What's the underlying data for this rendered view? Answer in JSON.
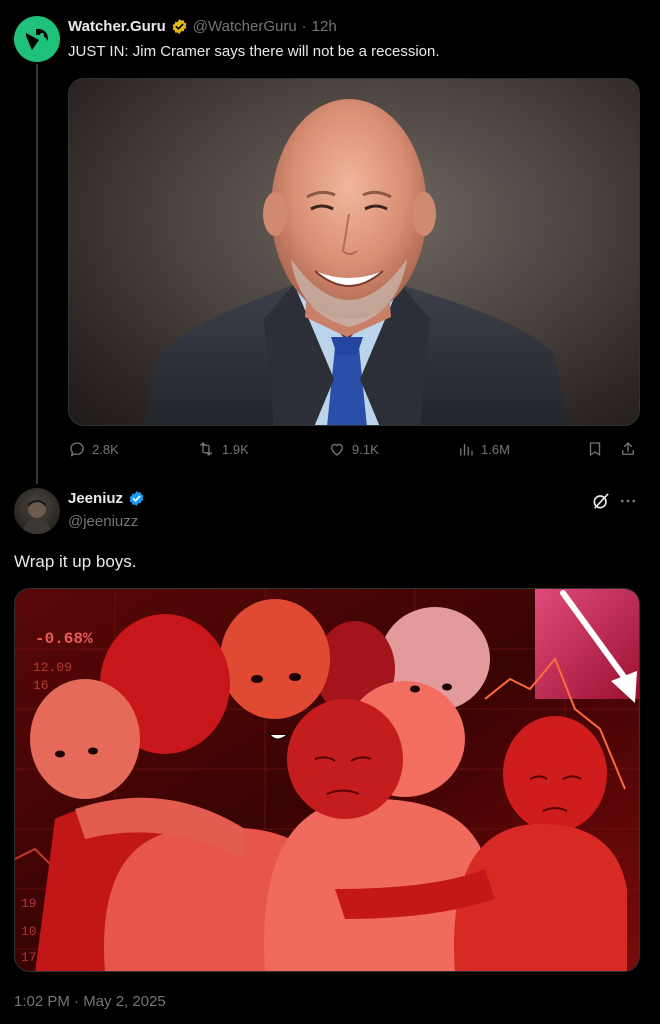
{
  "quoted_tweet": {
    "display_name": "Watcher.Guru",
    "handle": "@WatcherGuru",
    "separator": "·",
    "time_ago": "12h",
    "text": "JUST IN: Jim Cramer says there will not be a recession.",
    "actions": {
      "replies": "2.8K",
      "reposts": "1.9K",
      "likes": "9.1K",
      "views": "1.6M"
    }
  },
  "reply_tweet": {
    "display_name": "Jeeniuz",
    "handle": "@jeeniuzz",
    "text": "Wrap it up boys.",
    "timestamp": "1:02 PM · May 2, 2025"
  },
  "meme_chart_text": {
    "ticker_value": "-0.68%",
    "numbers_left": [
      "12.09",
      "16",
      "19",
      "10",
      "17"
    ]
  },
  "colors": {
    "background": "#000000",
    "text_primary": "#e7e9ea",
    "text_secondary": "#71767b",
    "verified_gold": "#e2b719",
    "verified_blue": "#1d9bf0",
    "watcher_green": "#1fc07a",
    "divider": "#333639"
  },
  "icons": [
    "watcher-guru-logo-icon",
    "verified-gold-icon",
    "reply-icon",
    "repost-icon",
    "like-icon",
    "views-icon",
    "bookmark-icon",
    "share-icon",
    "verified-blue-icon",
    "grok-icon",
    "more-icon"
  ]
}
